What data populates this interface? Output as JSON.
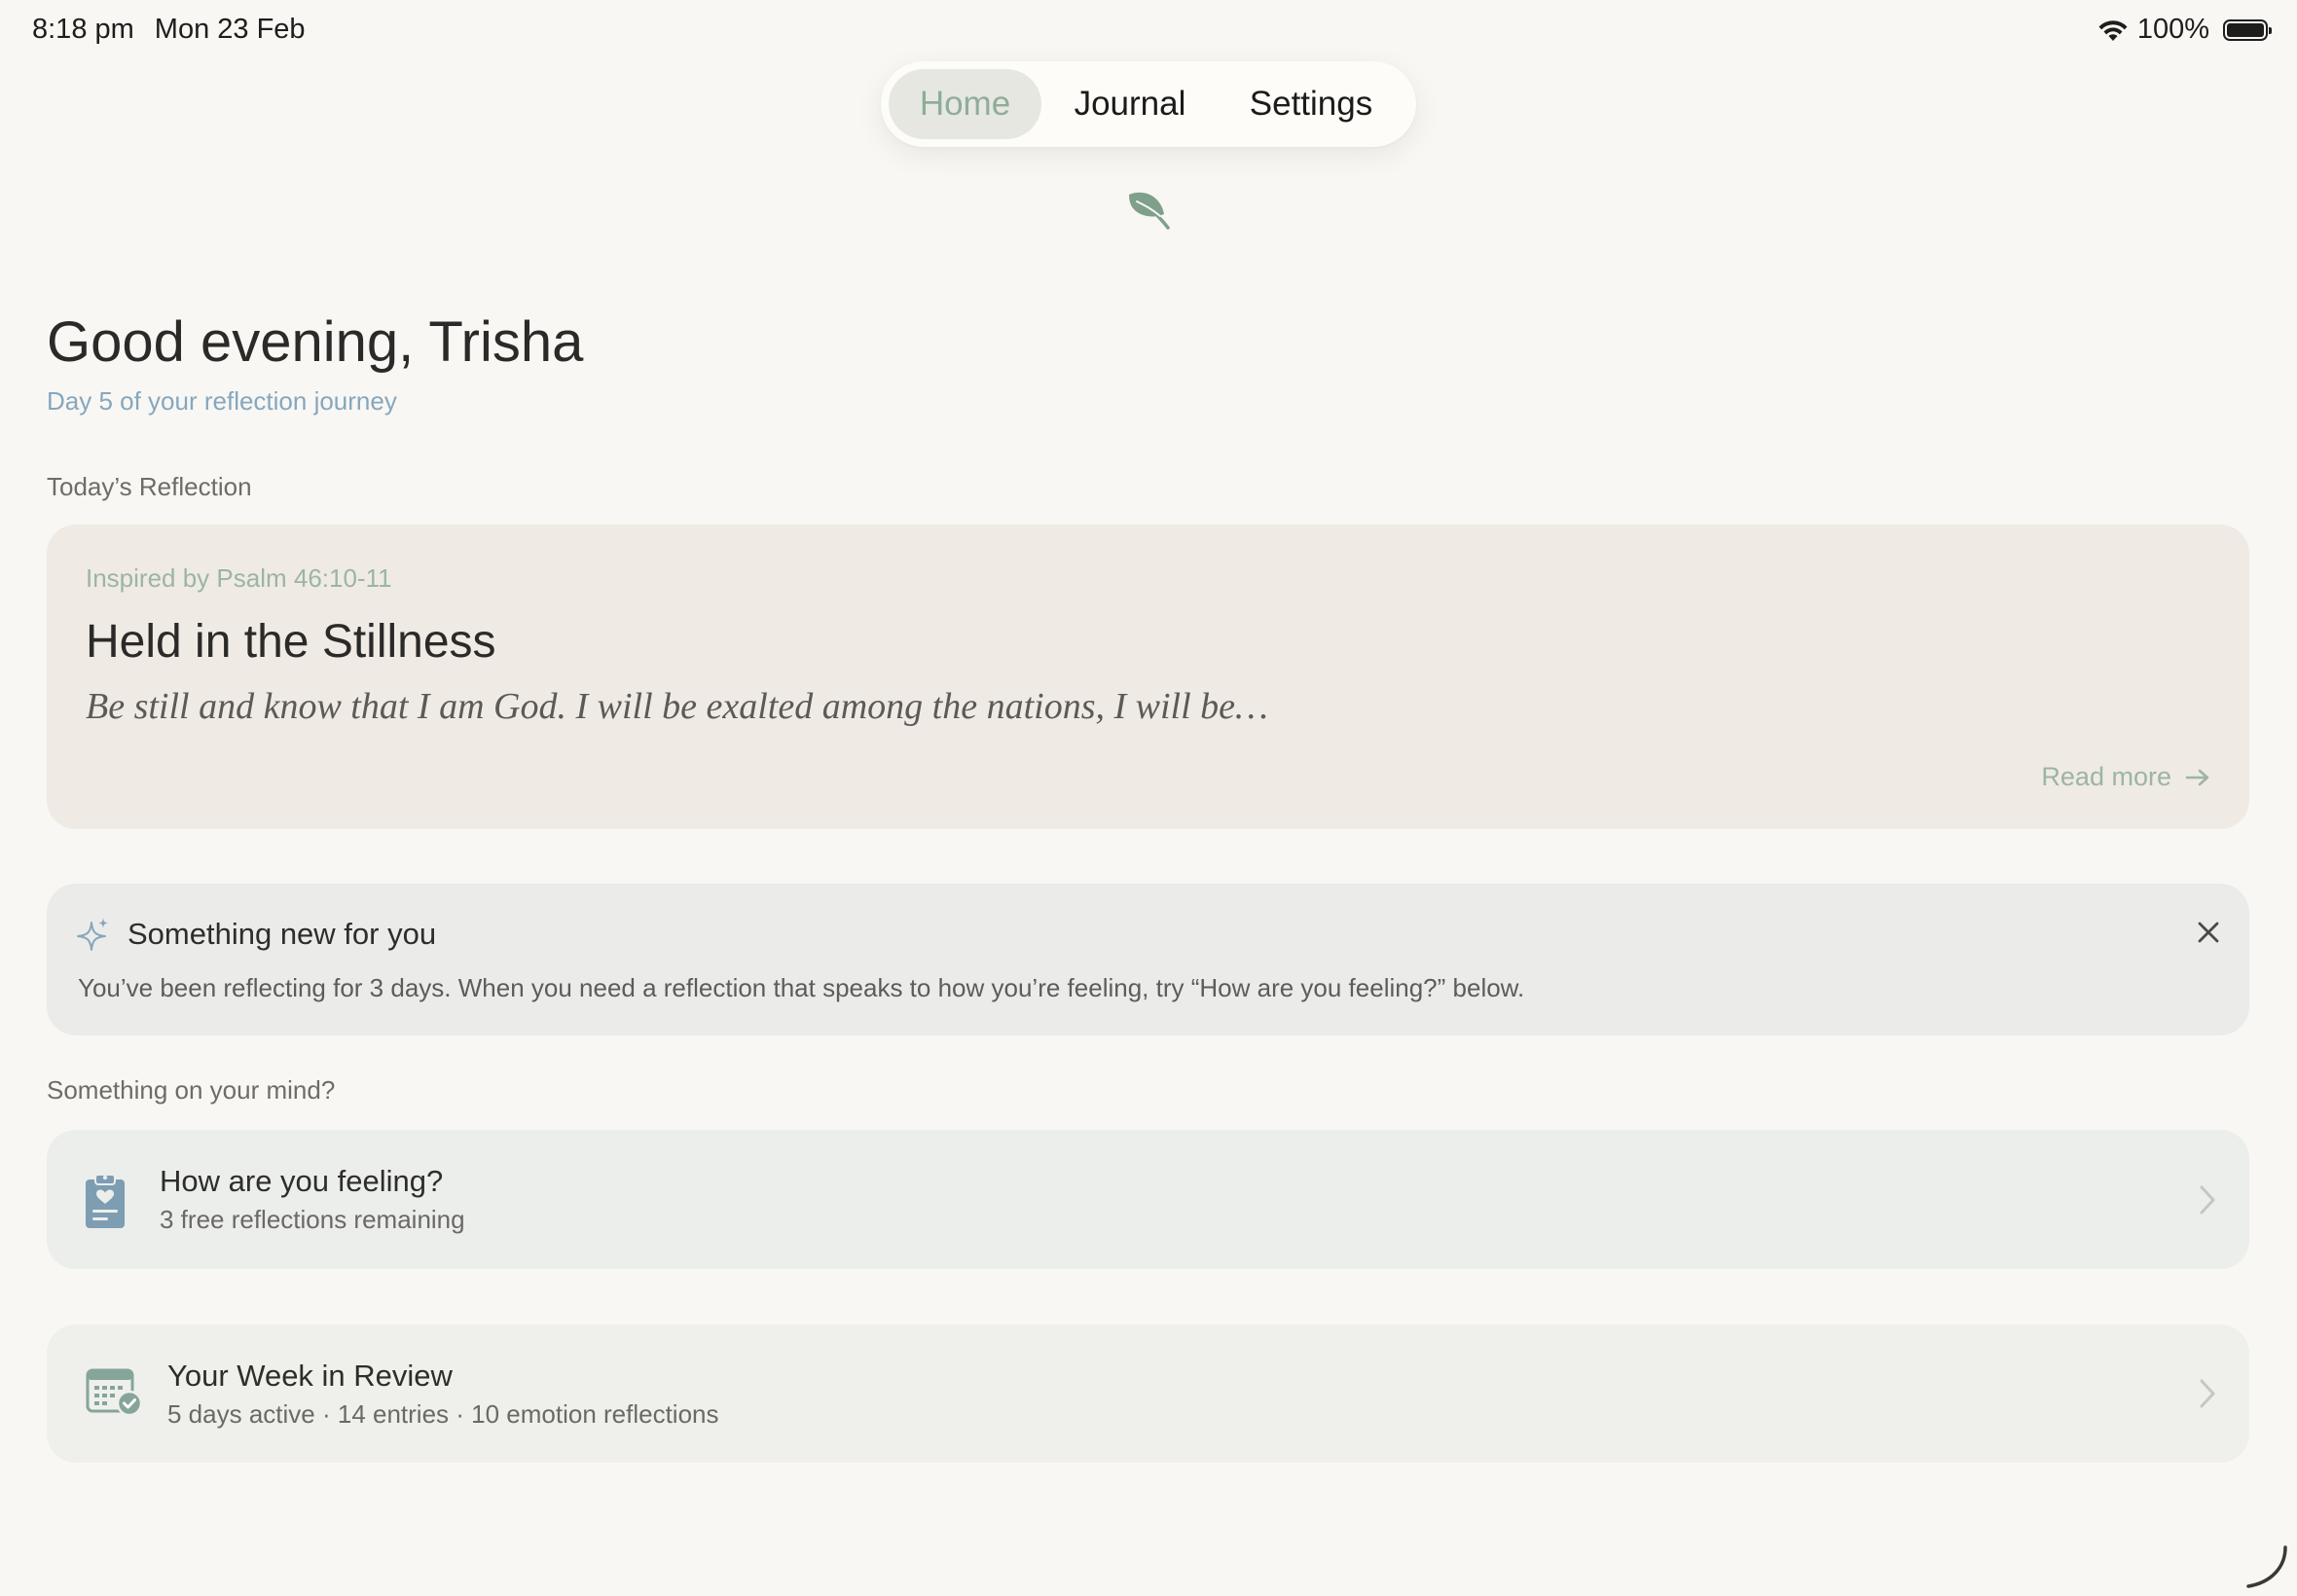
{
  "status_bar": {
    "time": "8:18 pm",
    "date": "Mon 23 Feb",
    "battery": "100%",
    "wifi_icon": "wifi-icon",
    "battery_icon": "battery-icon"
  },
  "tabs": {
    "home": "Home",
    "journal": "Journal",
    "settings": "Settings",
    "active": "Home"
  },
  "brand_icon": "leaf-icon",
  "greeting": {
    "title": "Good evening, Trisha",
    "subtitle": "Day 5 of your reflection journey"
  },
  "todays_reflection": {
    "section_label": "Today’s Reflection",
    "inspired_by": "Inspired by Psalm 46:10-11",
    "title": "Held in the Stillness",
    "verse_excerpt": "Be still and know that I am God. I will be exalted among the nations, I will be…",
    "read_more": "Read more"
  },
  "notice": {
    "title": "Something new for you",
    "body": "You’ve been reflecting for 3 days. When you need a reflection that speaks to how you’re feeling, try “How are you feeling?” below."
  },
  "mind": {
    "section_label": "Something on your mind?",
    "feeling": {
      "title": "How are you feeling?",
      "subtitle": "3 free reflections remaining"
    }
  },
  "week_review": {
    "title": "Your Week in Review",
    "subtitle": "5 days active · 14 entries · 10 emotion reflections"
  },
  "colors": {
    "background": "#f8f7f4",
    "accent_green": "#8fad98",
    "accent_blue": "#86a7bd",
    "reflection_card": "#efebe4",
    "notice_card": "#ebecea"
  }
}
